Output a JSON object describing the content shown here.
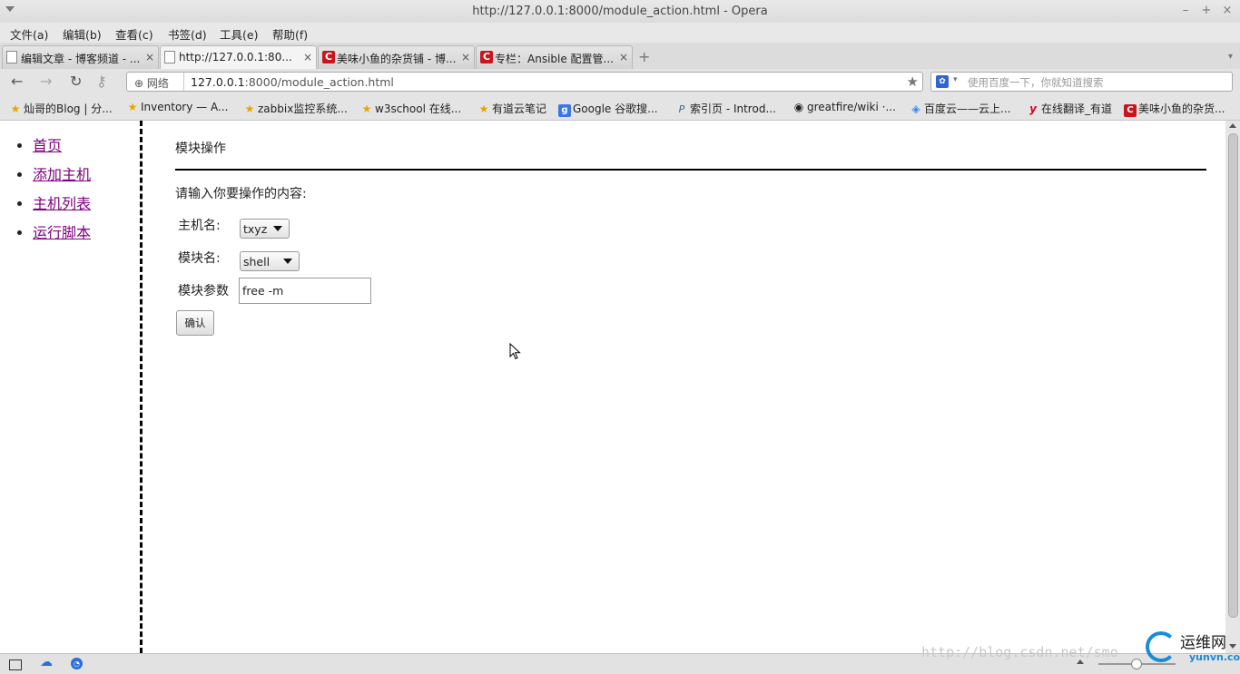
{
  "window": {
    "title": "http://127.0.0.1:8000/module_action.html - Opera",
    "minimize": "–",
    "maximize": "+",
    "close": "×"
  },
  "menu": [
    "文件(a)",
    "编辑(b)",
    "查看(c)",
    "书签(d)",
    "工具(e)",
    "帮助(f)"
  ],
  "tabs": [
    {
      "label": "编辑文章 - 博客频道 - ...",
      "icon": "page-icon"
    },
    {
      "label": "http://127.0.0.1:80...",
      "icon": "page-icon"
    },
    {
      "label": "美味小鱼的杂货铺 - 博...",
      "icon": "csdn-icon"
    },
    {
      "label": "专栏：Ansible 配置管...",
      "icon": "csdn-icon"
    }
  ],
  "tab_close": "×",
  "address": {
    "badge": "网络",
    "url_host": "127.0.0.1",
    "url_rest": ":8000/module_action.html",
    "search_placeholder": "使用百度一下，你就知道搜索"
  },
  "bookmarks": [
    {
      "label": "灿哥的Blog | 分...",
      "icon": "star-icon",
      "glyph": "★"
    },
    {
      "label": "Inventory — A...",
      "icon": "star-icon",
      "glyph": "★"
    },
    {
      "label": "zabbix监控系统...",
      "icon": "star-icon",
      "glyph": "★"
    },
    {
      "label": "w3school 在线...",
      "icon": "star-icon",
      "glyph": "★"
    },
    {
      "label": "有道云笔记",
      "icon": "star-icon",
      "glyph": "★"
    },
    {
      "label": "Google 谷歌搜...",
      "icon": "google-icon",
      "glyph": "g"
    },
    {
      "label": "索引页 - Introd...",
      "icon": "python-icon",
      "glyph": "P"
    },
    {
      "label": "greatfire/wiki ·...",
      "icon": "github-icon",
      "glyph": "◉"
    },
    {
      "label": "百度云——云上...",
      "icon": "baidu-cloud-icon",
      "glyph": "◈"
    },
    {
      "label": "在线翻译_有道",
      "icon": "youdao-icon",
      "glyph": "y"
    },
    {
      "label": "美味小鱼的杂货...",
      "icon": "csdn-icon",
      "glyph": "C"
    }
  ],
  "sidebar": {
    "links": [
      "首页",
      "添加主机",
      "主机列表",
      "运行脚本"
    ]
  },
  "main": {
    "page_title": "模块操作",
    "prompt": "请输入你要操作的内容:",
    "host_label": "主机名:",
    "host_value": "txyz",
    "module_label": "模块名:",
    "module_value": "shell",
    "args_label": "模块参数",
    "args_value": "free -m",
    "confirm_label": "确认"
  },
  "watermark": "http://blog.csdn.net/smo",
  "logo": {
    "cn": "运维网",
    "en": "yunvn.com"
  },
  "colors": {
    "visited_link": "#800080",
    "csdn_red": "#c8161d",
    "bookmark_star": "#e8a400"
  }
}
